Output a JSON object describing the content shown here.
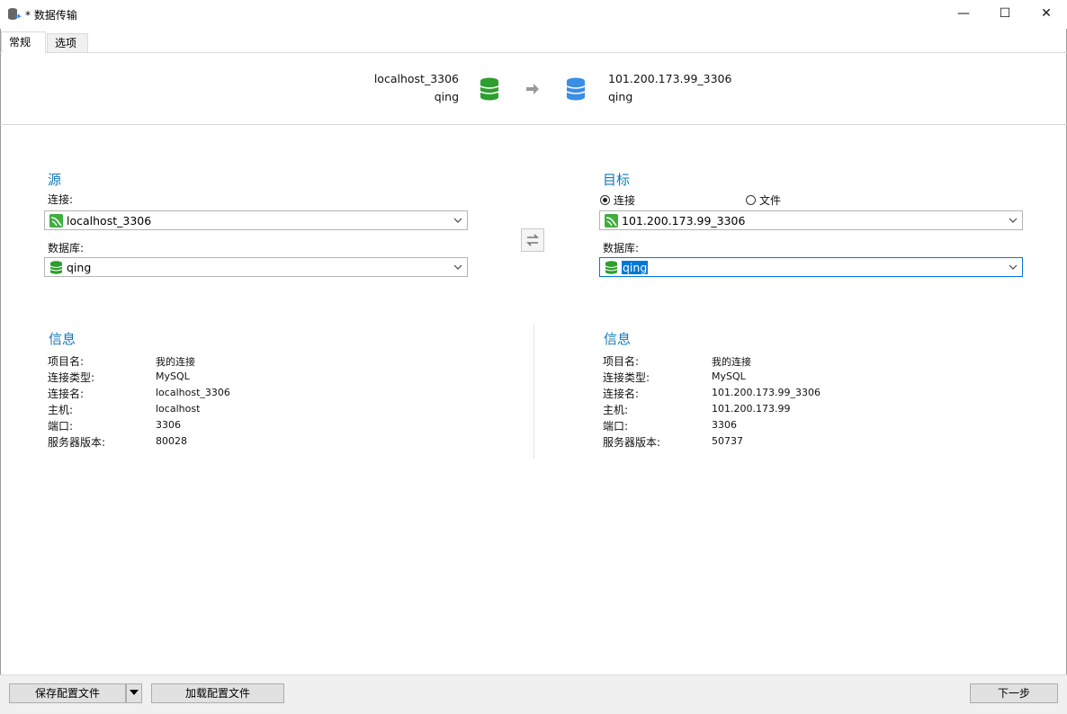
{
  "window": {
    "title": "* 数据传输",
    "minimize_glyph": "—",
    "maximize_glyph": "☐",
    "close_glyph": "✕"
  },
  "tabs": [
    {
      "label": "常规",
      "active": true
    },
    {
      "label": "选项",
      "active": false
    }
  ],
  "header": {
    "source_connection": "localhost_3306",
    "source_database": "qing",
    "target_connection": "101.200.173.99_3306",
    "target_database": "qing",
    "source_icon": "green-database-icon",
    "target_icon": "blue-database-icon",
    "arrow_icon": "right-arrow-icon"
  },
  "source": {
    "heading": "源",
    "connection_label": "连接:",
    "connection_value": "localhost_3306",
    "database_label": "数据库:",
    "database_value": "qing"
  },
  "target": {
    "heading": "目标",
    "radio_connection": "连接",
    "radio_file": "文件",
    "radio_selected": "连接",
    "connection_value": "101.200.173.99_3306",
    "database_label": "数据库:",
    "database_value": "qing"
  },
  "swap_icon": "swap-arrows-icon",
  "source_info": {
    "heading": "信息",
    "rows": [
      {
        "key": "项目名:",
        "value": "我的连接"
      },
      {
        "key": "连接类型:",
        "value": "MySQL"
      },
      {
        "key": "连接名:",
        "value": "localhost_3306"
      },
      {
        "key": "主机:",
        "value": "localhost"
      },
      {
        "key": "端口:",
        "value": "3306"
      },
      {
        "key": "服务器版本:",
        "value": "80028"
      }
    ]
  },
  "target_info": {
    "heading": "信息",
    "rows": [
      {
        "key": "项目名:",
        "value": "我的连接"
      },
      {
        "key": "连接类型:",
        "value": "MySQL"
      },
      {
        "key": "连接名:",
        "value": "101.200.173.99_3306"
      },
      {
        "key": "主机:",
        "value": "101.200.173.99"
      },
      {
        "key": "端口:",
        "value": "3306"
      },
      {
        "key": "服务器版本:",
        "value": "50737"
      }
    ]
  },
  "footer": {
    "save_profile": "保存配置文件",
    "load_profile": "加载配置文件",
    "next": "下一步"
  },
  "colors": {
    "accent": "#1479b8",
    "green_db": "#2e9e2e",
    "blue_db": "#3a8ee6",
    "selection": "#0078d7"
  }
}
